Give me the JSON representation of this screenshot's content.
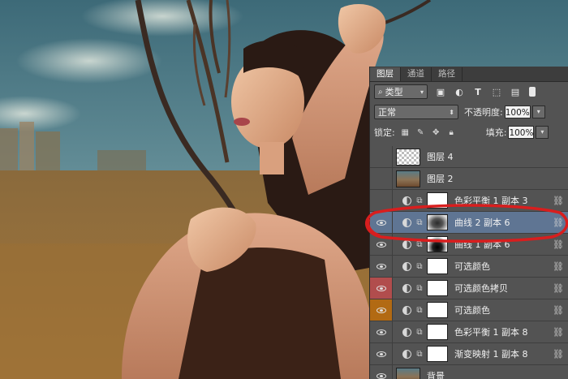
{
  "panel": {
    "tabs": [
      {
        "label": "图层"
      },
      {
        "label": "通道"
      },
      {
        "label": "路径"
      }
    ],
    "filter": {
      "kind_label": "类型",
      "search_icon": "search-icon"
    },
    "blend": {
      "mode": "正常",
      "opacity_label": "不透明度:",
      "opacity_value": "100%"
    },
    "lock": {
      "label": "锁定:",
      "fill_label": "填充:",
      "fill_value": "100%"
    },
    "layers": [
      {
        "name": "图层 4",
        "kind": "pixel",
        "visible": false,
        "thumb": "checker"
      },
      {
        "name": "图层 2",
        "kind": "pixel",
        "visible": false,
        "thumb": "photo"
      },
      {
        "name": "色彩平衡 1 副本 3",
        "kind": "adjustment",
        "visible": false,
        "mask": "white"
      },
      {
        "name": "曲线 2 副本 6",
        "kind": "adjustment",
        "visible": true,
        "selected": true,
        "mask": "blurdark"
      },
      {
        "name": "曲线 1 副本 6",
        "kind": "adjustment",
        "visible": true,
        "mask": "bandblack"
      },
      {
        "name": "可选颜色",
        "kind": "adjustment",
        "visible": true,
        "mask": "white"
      },
      {
        "name": "可选颜色拷贝",
        "kind": "adjustment",
        "visible": true,
        "eye_color": "red",
        "mask": "white"
      },
      {
        "name": "可选颜色",
        "kind": "adjustment",
        "visible": true,
        "eye_color": "orange",
        "mask": "white"
      },
      {
        "name": "色彩平衡 1 副本 8",
        "kind": "adjustment",
        "visible": true,
        "mask": "white"
      },
      {
        "name": "渐变映射 1 副本 8",
        "kind": "adjustment",
        "visible": true,
        "mask": "white"
      },
      {
        "name": "背景",
        "kind": "background",
        "visible": true,
        "thumb": "photo"
      }
    ]
  },
  "colors": {
    "panel_bg": "#535353",
    "selected_row": "#5f7593",
    "red_eye": "#b14d4d",
    "orange_eye": "#b26a13",
    "annotation": "#d81e1e"
  }
}
